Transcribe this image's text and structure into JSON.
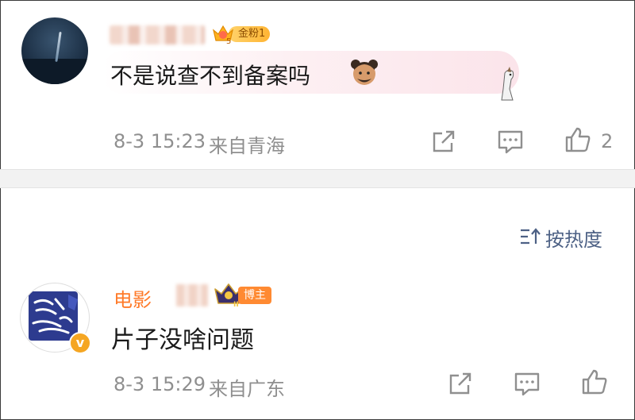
{
  "comments": [
    {
      "fan_badge": "金粉1",
      "fan_level": "5",
      "text": "不是说查不到备案吗",
      "time": "8-3 15:23",
      "location": "来自青海",
      "like_count": "2"
    },
    {
      "name": "电影",
      "role_badge": "博主",
      "crown_level": "II",
      "verified_mark": "v",
      "text": "片子没啥问题",
      "time": "8-3 15:29",
      "location": "来自广东"
    }
  ],
  "sort": {
    "label": "按热度"
  },
  "colors": {
    "link": "#4d6185",
    "meta": "#8f8f8f",
    "name": "#ff7a28",
    "badge": "#ff8a32"
  },
  "icons": [
    "share-icon",
    "comment-icon",
    "like-icon",
    "sort-icon",
    "crown-icon",
    "verified-icon"
  ]
}
